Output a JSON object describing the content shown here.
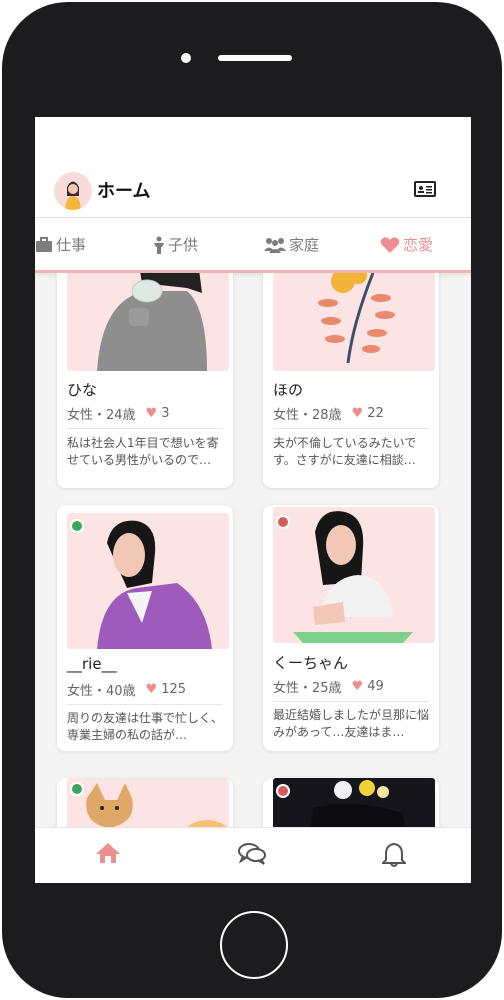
{
  "header": {
    "title": "ホーム"
  },
  "tabs": [
    {
      "label": "仕事",
      "icon": "briefcase-icon",
      "active": false
    },
    {
      "label": "子供",
      "icon": "child-icon",
      "active": false
    },
    {
      "label": "家庭",
      "icon": "family-icon",
      "active": false
    },
    {
      "label": "恋愛",
      "icon": "heart-icon",
      "active": true
    }
  ],
  "cards": [
    {
      "name": "ひな",
      "meta": "女性・24歳",
      "likes": "3",
      "snippet": "私は社会人1年目で想いを寄せている男性がいるので…",
      "status": ""
    },
    {
      "name": "ほの",
      "meta": "女性・28歳",
      "likes": "22",
      "snippet": "夫が不倫しているみたいです。さすがに友達に相談…",
      "status": ""
    },
    {
      "name": "__rie__",
      "meta": "女性・40歳",
      "likes": "125",
      "snippet": "周りの友達は仕事で忙しく、専業主婦の私の話が…",
      "status": "online"
    },
    {
      "name": "くーちゃん",
      "meta": "女性・25歳",
      "likes": "49",
      "snippet": "最近結婚しましたが旦那に悩みがあって…友達はま…",
      "status": "away"
    },
    {
      "name": "",
      "meta": "",
      "likes": "",
      "snippet": "",
      "status": "online"
    },
    {
      "name": "",
      "meta": "",
      "likes": "",
      "snippet": "",
      "status": "away"
    }
  ],
  "bottom_nav": [
    {
      "icon": "home-icon",
      "active": true
    },
    {
      "icon": "chat-icon",
      "active": false
    },
    {
      "icon": "bell-icon",
      "active": false
    }
  ],
  "colors": {
    "accent": "#ec8f8f",
    "online": "#38a85e",
    "away": "#d65b5b",
    "thumb_bg": "#fce4e4"
  }
}
